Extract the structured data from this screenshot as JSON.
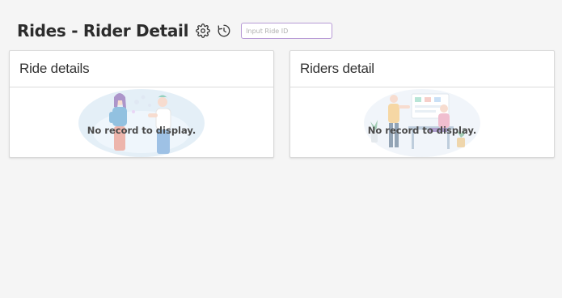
{
  "header": {
    "title": "Rides - Rider Detail",
    "settings_icon": "gear-icon",
    "history_icon": "history-clock-icon",
    "ride_id_input": {
      "value": "",
      "placeholder": "Input Ride ID"
    }
  },
  "panels": [
    {
      "title": "Ride details",
      "empty_message": "No record to display.",
      "illustration": "two-people-talking-illustration"
    },
    {
      "title": "Riders detail",
      "empty_message": "No record to display.",
      "illustration": "office-meeting-illustration"
    }
  ],
  "colors": {
    "background": "#f5f5f5",
    "input_border": "#b79ad6",
    "card_border": "#d9d9d9"
  }
}
